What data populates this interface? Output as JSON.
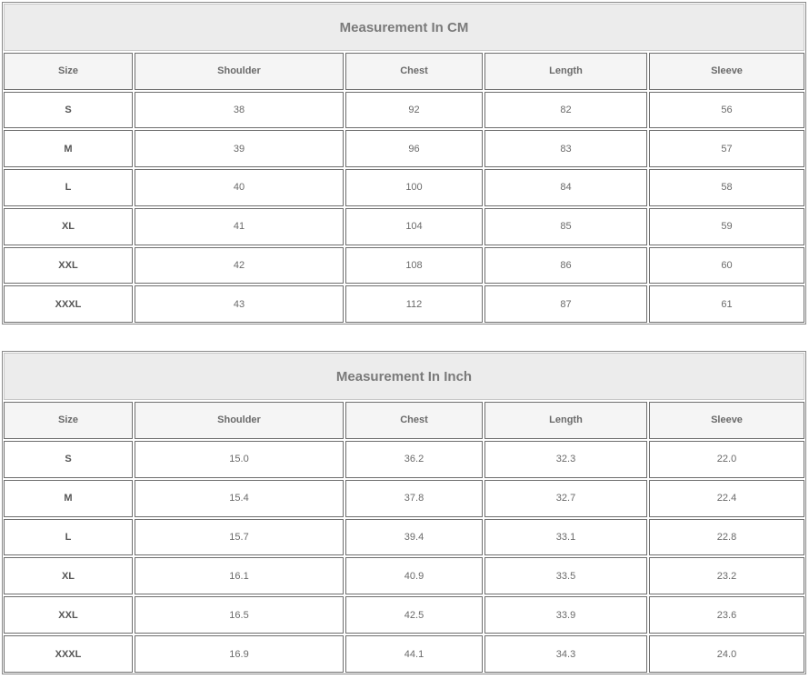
{
  "tables": [
    {
      "title": "Measurement In CM",
      "headers": [
        "Size",
        "Shoulder",
        "Chest",
        "Length",
        "Sleeve"
      ],
      "rows": [
        [
          "S",
          "38",
          "92",
          "82",
          "56"
        ],
        [
          "M",
          "39",
          "96",
          "83",
          "57"
        ],
        [
          "L",
          "40",
          "100",
          "84",
          "58"
        ],
        [
          "XL",
          "41",
          "104",
          "85",
          "59"
        ],
        [
          "XXL",
          "42",
          "108",
          "86",
          "60"
        ],
        [
          "XXXL",
          "43",
          "112",
          "87",
          "61"
        ]
      ]
    },
    {
      "title": "Measurement In Inch",
      "headers": [
        "Size",
        "Shoulder",
        "Chest",
        "Length",
        "Sleeve"
      ],
      "rows": [
        [
          "S",
          "15.0",
          "36.2",
          "32.3",
          "22.0"
        ],
        [
          "M",
          "15.4",
          "37.8",
          "32.7",
          "22.4"
        ],
        [
          "L",
          "15.7",
          "39.4",
          "33.1",
          "22.8"
        ],
        [
          "XL",
          "16.1",
          "40.9",
          "33.5",
          "23.2"
        ],
        [
          "XXL",
          "16.5",
          "42.5",
          "33.9",
          "23.6"
        ],
        [
          "XXXL",
          "16.9",
          "44.1",
          "34.3",
          "24.0"
        ]
      ]
    }
  ]
}
